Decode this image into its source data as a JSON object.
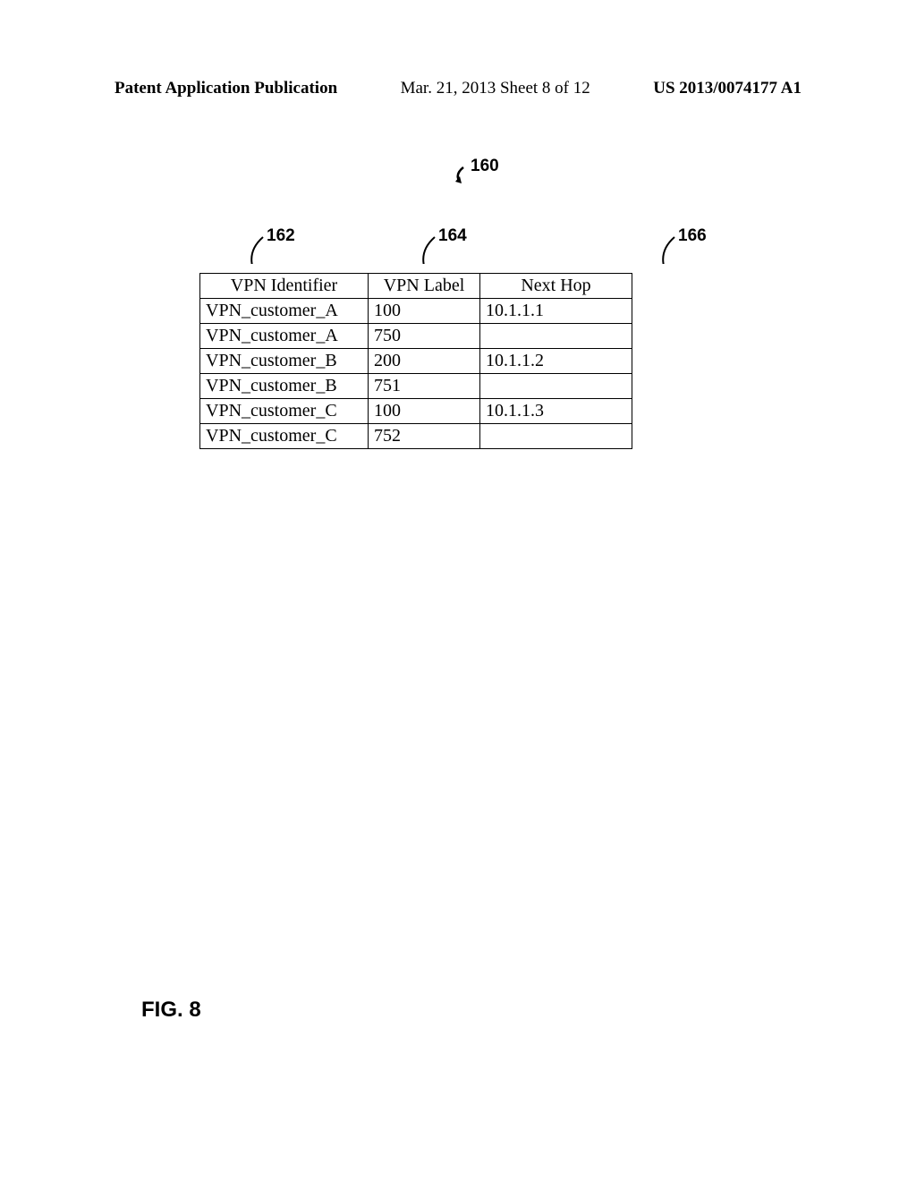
{
  "header": {
    "left": "Patent Application Publication",
    "center": "Mar. 21, 2013   Sheet 8 of 12",
    "right": "US 2013/0074177 A1"
  },
  "references": {
    "main": "160",
    "col1": "162",
    "col2": "164",
    "col3": "166"
  },
  "table": {
    "headers": {
      "vpn_id": "VPN Identifier",
      "vpn_label": "VPN Label",
      "next_hop": "Next Hop"
    },
    "rows": [
      {
        "vpn_id": "VPN_customer_A",
        "vpn_label": "100",
        "next_hop": "10.1.1.1"
      },
      {
        "vpn_id": "VPN_customer_A",
        "vpn_label": "750",
        "next_hop": ""
      },
      {
        "vpn_id": "VPN_customer_B",
        "vpn_label": "200",
        "next_hop": "10.1.1.2"
      },
      {
        "vpn_id": "VPN_customer_B",
        "vpn_label": "751",
        "next_hop": ""
      },
      {
        "vpn_id": "VPN_customer_C",
        "vpn_label": "100",
        "next_hop": "10.1.1.3"
      },
      {
        "vpn_id": "VPN_customer_C",
        "vpn_label": "752",
        "next_hop": ""
      }
    ]
  },
  "figure_label": "FIG. 8"
}
